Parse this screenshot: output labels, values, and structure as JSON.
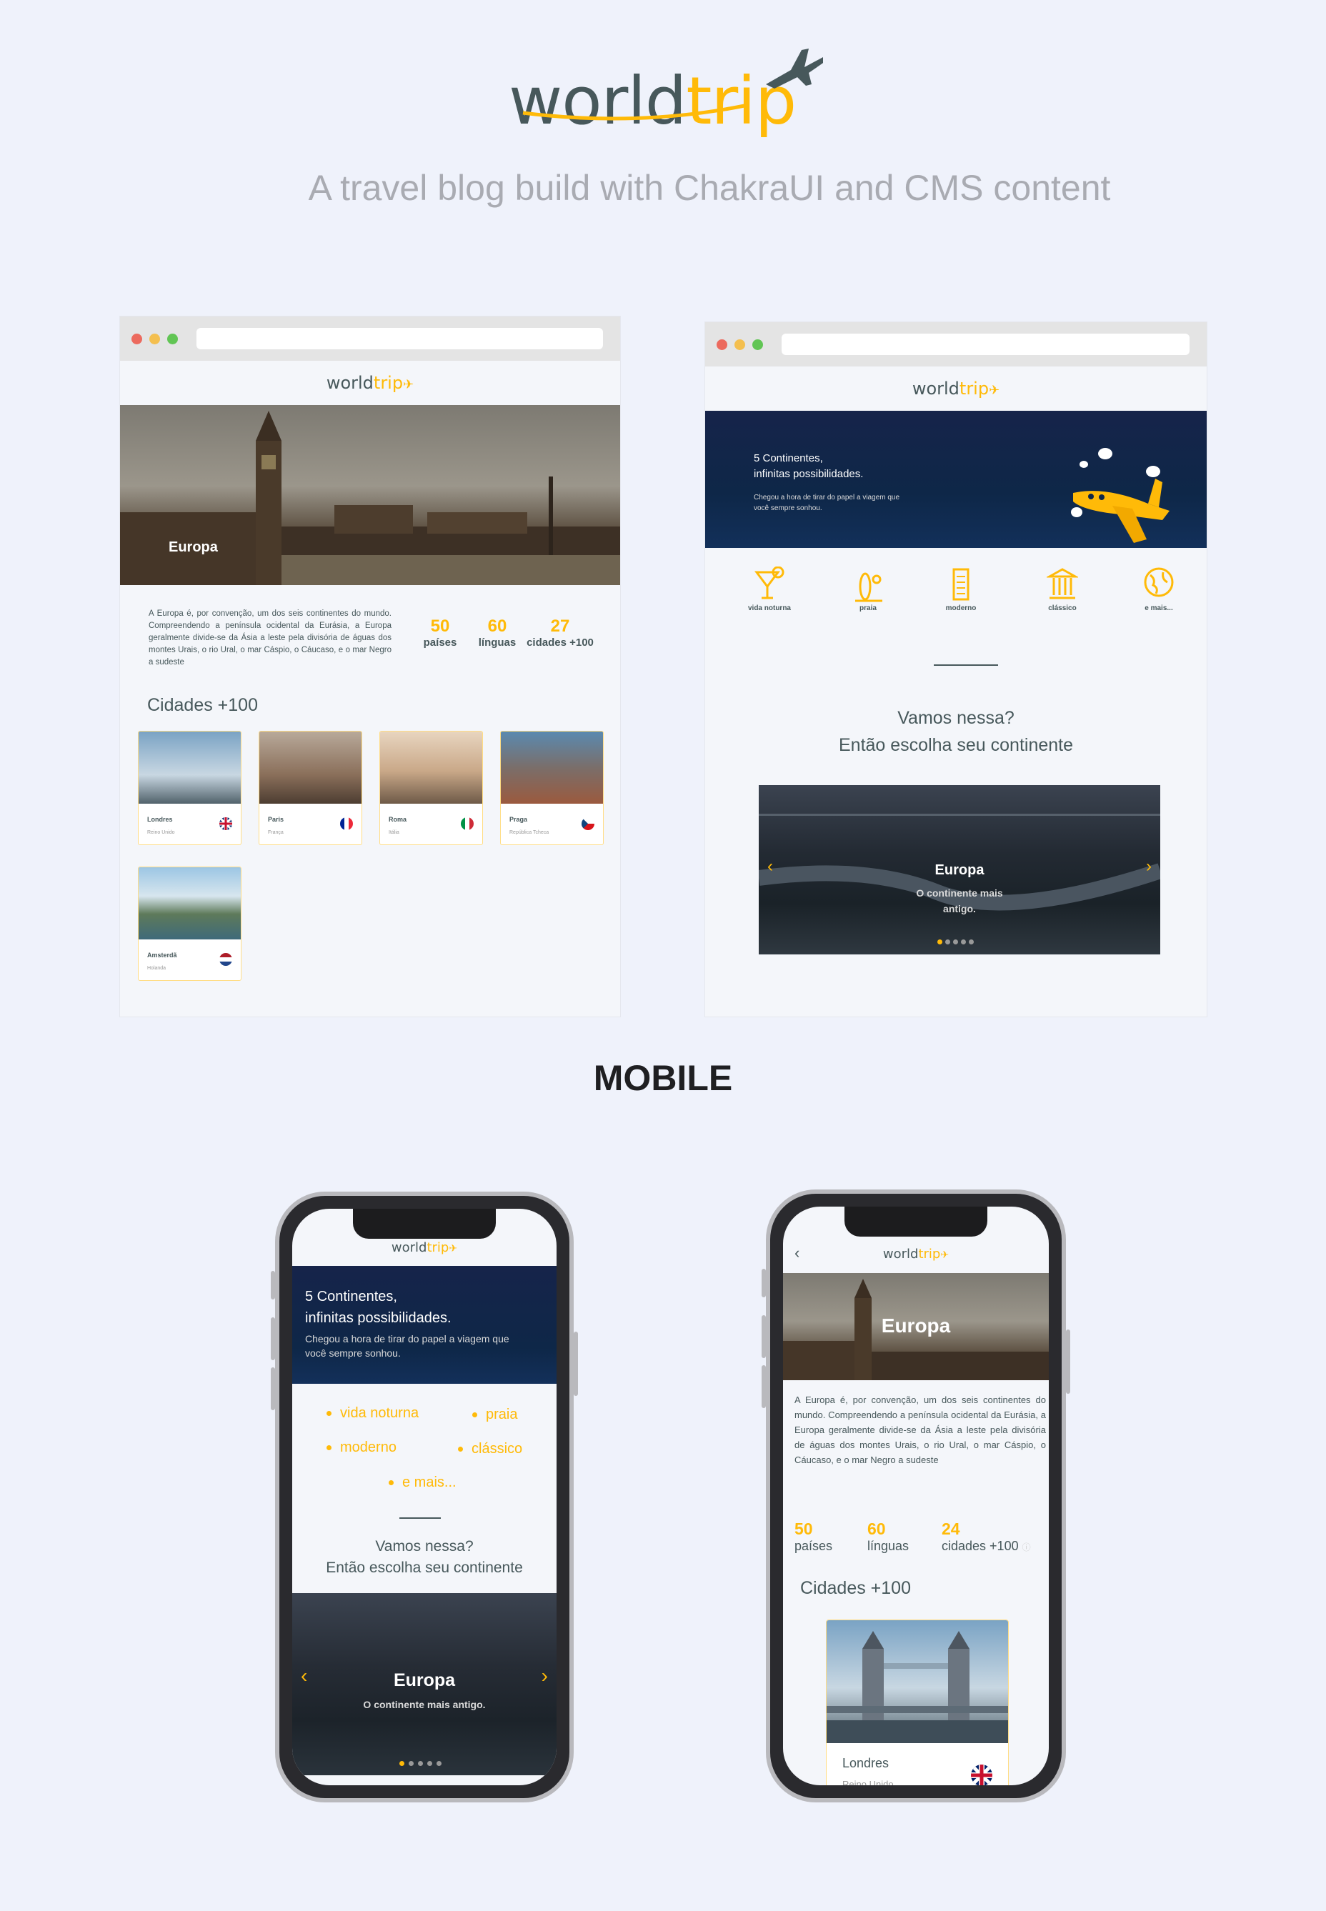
{
  "header": {
    "logo_word": "world",
    "logo_accent": "trip",
    "tagline": "A travel blog build with ChakraUI and  CMS content",
    "mobile_heading": "MOBILE"
  },
  "colors": {
    "accent": "#ffba08",
    "text": "#47585b",
    "background": "#eff2fb",
    "banner": "#0e2748"
  },
  "desktop_continent": {
    "logo_word": "world",
    "logo_accent": "trip",
    "hero_title": "Europa",
    "description": "A Europa é, por convenção, um dos seis continentes do mundo. Compreendendo a península ocidental da Eurásia, a Europa geralmente divide-se da Ásia a leste pela divisória de águas dos montes Urais, o rio Ural, o mar Cáspio, o Cáucaso, e o mar Negro a sudeste",
    "stats": [
      {
        "value": "50",
        "label": "países"
      },
      {
        "value": "60",
        "label": "línguas"
      },
      {
        "value": "27",
        "label": "cidades +100"
      }
    ],
    "cities_title": "Cidades +100",
    "cities": [
      {
        "name": "Londres",
        "country": "Reino Unido",
        "flag": "uk-flag-icon"
      },
      {
        "name": "Paris",
        "country": "França",
        "flag": "france-flag-icon"
      },
      {
        "name": "Roma",
        "country": "Itália",
        "flag": "italy-flag-icon"
      },
      {
        "name": "Praga",
        "country": "República Tcheca",
        "flag": "czech-flag-icon"
      },
      {
        "name": "Amsterdã",
        "country": "Holanda",
        "flag": "netherlands-flag-icon"
      }
    ]
  },
  "desktop_home": {
    "logo_word": "world",
    "logo_accent": "trip",
    "banner_title_1": "5 Continentes,",
    "banner_title_2": "infinitas possibilidades.",
    "banner_sub_1": "Chegou a hora de tirar do papel a viagem que",
    "banner_sub_2": "você sempre sonhou.",
    "categories": [
      {
        "label": "vida noturna",
        "icon": "cocktail-icon"
      },
      {
        "label": "praia",
        "icon": "surfboard-icon"
      },
      {
        "label": "moderno",
        "icon": "building-icon"
      },
      {
        "label": "clássico",
        "icon": "museum-icon"
      },
      {
        "label": "e mais...",
        "icon": "globe-icon"
      }
    ],
    "cta_1": "Vamos nessa?",
    "cta_2": "Então escolha seu continente",
    "slide_title": "Europa",
    "slide_sub_1": "O continente mais",
    "slide_sub_2": "antigo."
  },
  "mobile_home": {
    "logo_word": "world",
    "logo_accent": "trip",
    "banner_title_1": "5 Continentes,",
    "banner_title_2": "infinitas possibilidades.",
    "banner_sub_1": "Chegou a hora de tirar do papel a viagem que",
    "banner_sub_2": "você sempre sonhou.",
    "bullets": [
      "vida noturna",
      "praia",
      "moderno",
      "clássico",
      "e mais..."
    ],
    "cta_1": "Vamos nessa?",
    "cta_2": "Então escolha seu continente",
    "slide_title": "Europa",
    "slide_sub": "O continente mais antigo."
  },
  "mobile_continent": {
    "logo_word": "world",
    "logo_accent": "trip",
    "back": "‹",
    "hero_title": "Europa",
    "description": "A Europa é, por convenção, um dos seis continentes do mundo. Compreendendo a península ocidental da Eurásia, a Europa geralmente divide-se da Ásia a leste pela divisória de águas dos montes Urais, o rio Ural, o mar Cáspio, o Cáucaso, e o mar Negro a sudeste",
    "stats": [
      {
        "value": "50",
        "label": "países"
      },
      {
        "value": "60",
        "label": "línguas"
      },
      {
        "value": "24",
        "label": "cidades +100"
      }
    ],
    "cities_title": "Cidades +100",
    "city_name": "Londres",
    "city_country": "Reino Unido"
  }
}
